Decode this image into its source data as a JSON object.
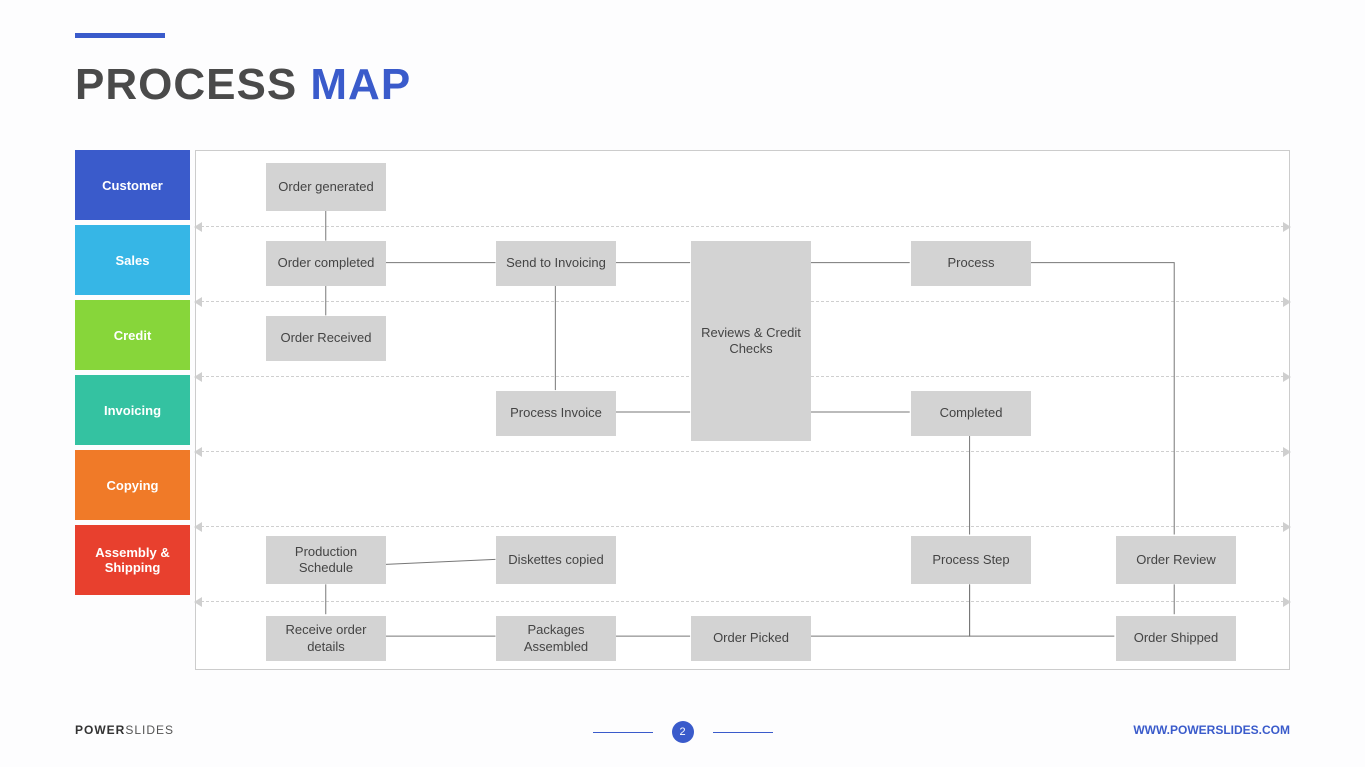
{
  "title": {
    "word1": "PROCESS",
    "word2": "MAP"
  },
  "lanes": [
    {
      "key": "customer",
      "label": "Customer"
    },
    {
      "key": "sales",
      "label": "Sales"
    },
    {
      "key": "credit",
      "label": "Credit"
    },
    {
      "key": "invoicing",
      "label": "Invoicing"
    },
    {
      "key": "copying",
      "label": "Copying"
    },
    {
      "key": "shipping",
      "label": "Assembly & Shipping"
    }
  ],
  "boxes": {
    "order_generated": "Order generated",
    "order_completed": "Order completed",
    "order_received": "Order Received",
    "send_to_invoicing": "Send to Invoicing",
    "reviews_credit": "Reviews & Credit Checks",
    "process": "Process",
    "process_invoice": "Process Invoice",
    "completed": "Completed",
    "production_sched": "Production Schedule",
    "diskettes_copied": "Diskettes copied",
    "process_step": "Process Step",
    "order_review": "Order Review",
    "receive_details": "Receive order details",
    "packages_assembled": "Packages Assembled",
    "order_picked": "Order Picked",
    "order_shipped": "Order Shipped"
  },
  "flows": [
    [
      "order_generated",
      "order_completed"
    ],
    [
      "order_completed",
      "order_received"
    ],
    [
      "order_completed",
      "send_to_invoicing"
    ],
    [
      "send_to_invoicing",
      "reviews_credit"
    ],
    [
      "send_to_invoicing",
      "process_invoice"
    ],
    [
      "reviews_credit",
      "process"
    ],
    [
      "reviews_credit",
      "completed"
    ],
    [
      "completed",
      "process_step"
    ],
    [
      "process",
      "order_review"
    ],
    [
      "production_sched",
      "diskettes_copied"
    ],
    [
      "production_sched",
      "receive_details"
    ],
    [
      "receive_details",
      "packages_assembled"
    ],
    [
      "packages_assembled",
      "order_picked"
    ],
    [
      "order_picked",
      "process_step"
    ],
    [
      "process_step",
      "order_shipped"
    ],
    [
      "order_shipped",
      "order_review"
    ]
  ],
  "footer": {
    "brand_bold": "POWER",
    "brand_light": "SLIDES",
    "page": "2",
    "url": "WWW.POWERSLIDES.COM"
  }
}
